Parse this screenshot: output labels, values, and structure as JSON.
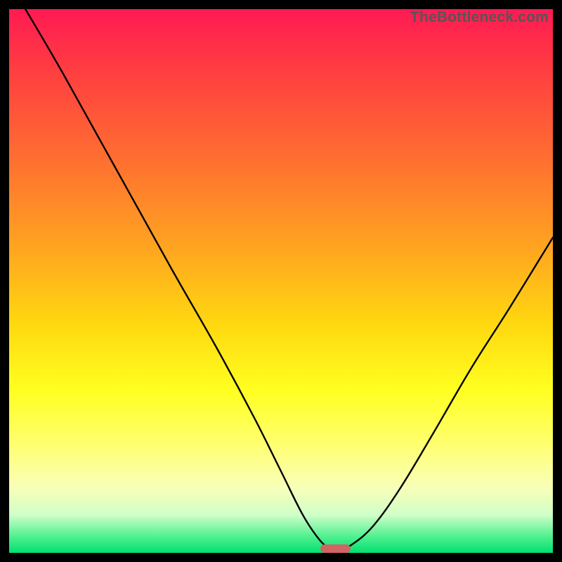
{
  "watermark": "TheBottleneck.com",
  "chart_data": {
    "type": "line",
    "title": "",
    "xlabel": "",
    "ylabel": "",
    "xlim": [
      0,
      100
    ],
    "ylim": [
      0,
      100
    ],
    "series": [
      {
        "name": "bottleneck-curve",
        "x": [
          3,
          10,
          20,
          30,
          38,
          45,
          50,
          54,
          57,
          59,
          60.5,
          63,
          67,
          72,
          78,
          85,
          92,
          100
        ],
        "y": [
          100,
          88,
          70,
          52,
          38,
          25,
          15,
          7,
          2.5,
          0.8,
          0.5,
          1.5,
          5,
          12,
          22,
          34,
          45,
          58
        ]
      }
    ],
    "marker": {
      "x_center": 60,
      "y": 0.8,
      "width_pct": 5.5,
      "height_pct": 1.6
    },
    "gradient_stops": [
      {
        "pct": 0,
        "color": "#ff1a53"
      },
      {
        "pct": 12,
        "color": "#ff4040"
      },
      {
        "pct": 28,
        "color": "#ff7030"
      },
      {
        "pct": 44,
        "color": "#ffa520"
      },
      {
        "pct": 58,
        "color": "#ffd810"
      },
      {
        "pct": 70,
        "color": "#ffff20"
      },
      {
        "pct": 80,
        "color": "#ffff70"
      },
      {
        "pct": 88,
        "color": "#f8ffb8"
      },
      {
        "pct": 93,
        "color": "#d0ffc8"
      },
      {
        "pct": 97,
        "color": "#50f090"
      },
      {
        "pct": 100,
        "color": "#00e070"
      }
    ]
  }
}
